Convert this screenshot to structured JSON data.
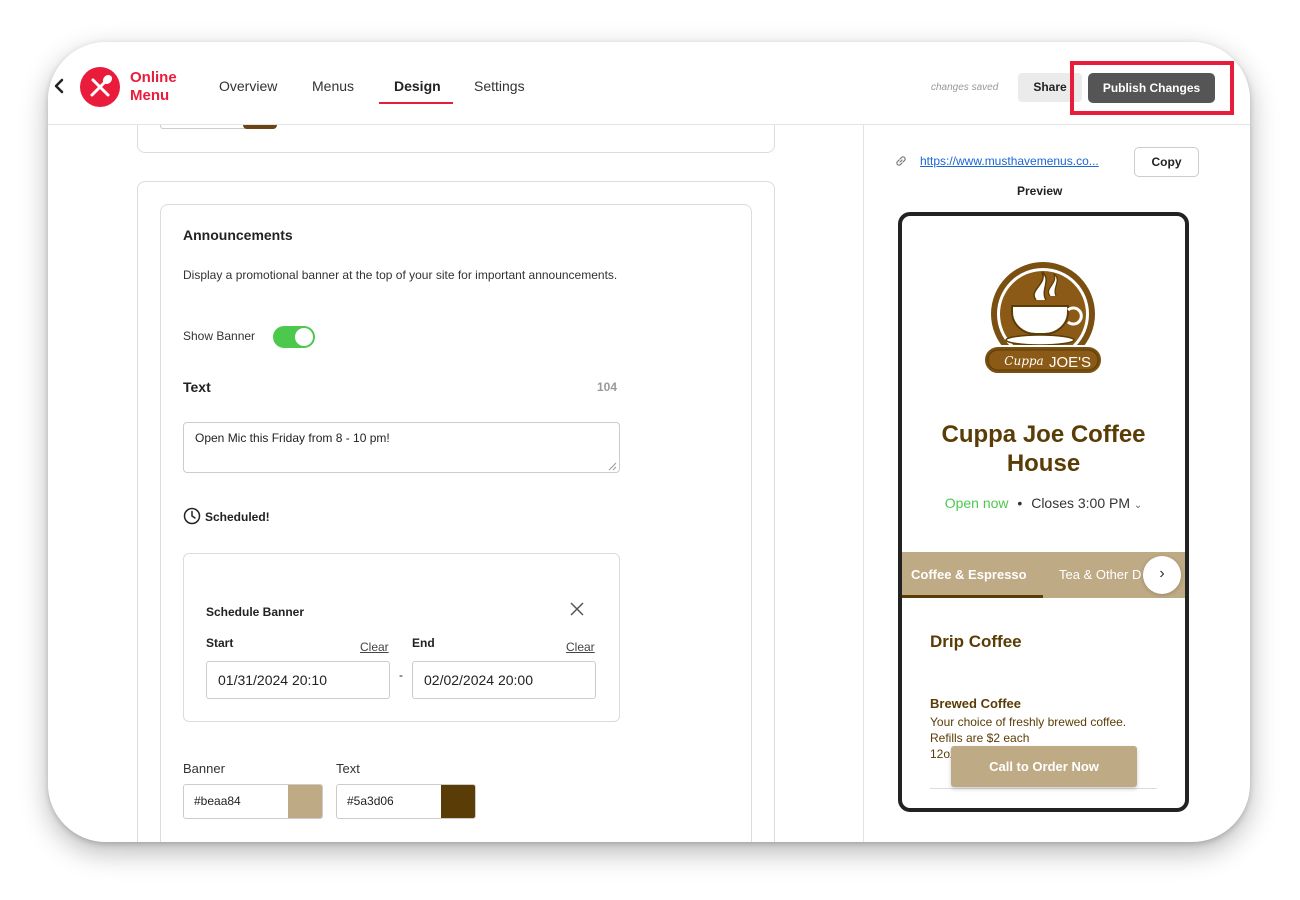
{
  "header": {
    "brand": "Online\nMenu",
    "brand_line1": "Online",
    "brand_line2": "Menu",
    "nav": [
      {
        "label": "Overview"
      },
      {
        "label": "Menus"
      },
      {
        "label": "Design"
      },
      {
        "label": "Settings"
      }
    ],
    "active_tab": "Design",
    "status": "changes saved",
    "share_label": "Share",
    "publish_label": "Publish Changes"
  },
  "announcements": {
    "title": "Announcements",
    "description": "Display a promotional banner at the top of your site for important announcements.",
    "show_banner_label": "Show Banner",
    "show_banner_on": true,
    "text_label": "Text",
    "char_count": "104",
    "text_value": "Open Mic this Friday from 8 - 10 pm!",
    "scheduled_label": "Scheduled!",
    "schedule": {
      "title": "Schedule Banner",
      "start_label": "Start",
      "end_label": "End",
      "clear_label": "Clear",
      "start_value": "01/31/2024 20:10",
      "separator": "-",
      "end_value": "02/02/2024 20:00"
    },
    "banner_color_label": "Banner",
    "banner_color": "#beaa84",
    "text_color_label": "Text",
    "text_color": "#5a3d06"
  },
  "preview": {
    "url": "https://www.musthavemenus.co...",
    "copy_label": "Copy",
    "preview_label": "Preview",
    "logo_text_cuppa": "Cuppa",
    "logo_text_joes": "JOE'S",
    "shop_name": "Cuppa Joe Coffee House",
    "open_status": "Open now",
    "bullet": "•",
    "closes": "Closes 3:00 PM",
    "tabs": [
      {
        "label": "Coffee & Espresso"
      },
      {
        "label": "Tea & Other D"
      }
    ],
    "category": "Drip Coffee",
    "item_name": "Brewed Coffee",
    "item_desc": "Your choice of freshly brewed coffee. Refills are $2 each",
    "item_size": "12oz",
    "call_label": "Call to Order Now"
  },
  "colors": {
    "accent": "#ea1c3c",
    "toggle_on": "#4cc94c",
    "banner": "#beaa84",
    "brown": "#5a3d06"
  }
}
